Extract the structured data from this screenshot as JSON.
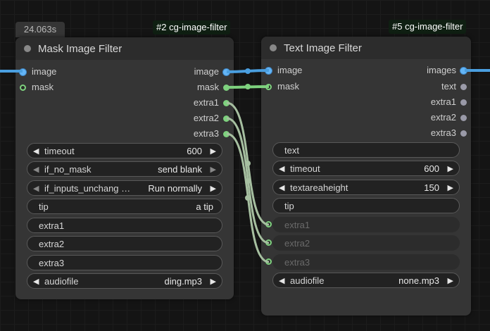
{
  "timer": "24.063s",
  "badges": {
    "node1": "#2 cg-image-filter",
    "node2": "#5 cg-image-filter"
  },
  "colors": {
    "image_wire": "#4a9fe0",
    "mask_wire": "#7ed17e",
    "extra_wire": "#a6bfa0",
    "node_bg": "#353535",
    "canvas_bg": "#141414"
  },
  "node1": {
    "title": "Mask Image Filter",
    "inputs": [
      {
        "label": "image",
        "type": "image"
      },
      {
        "label": "mask",
        "type": "mask"
      }
    ],
    "outputs": [
      {
        "label": "image",
        "type": "image"
      },
      {
        "label": "mask",
        "type": "mask"
      },
      {
        "label": "extra1",
        "type": "extra"
      },
      {
        "label": "extra2",
        "type": "extra"
      },
      {
        "label": "extra3",
        "type": "extra"
      }
    ],
    "widgets": [
      {
        "label": "timeout",
        "value": "600"
      },
      {
        "label": "if_no_mask",
        "value": "send blank"
      },
      {
        "label": "if_inputs_unchang …",
        "value": "Run normally"
      },
      {
        "label": "tip",
        "value": "a tip"
      },
      {
        "label": "extra1",
        "value": ""
      },
      {
        "label": "extra2",
        "value": ""
      },
      {
        "label": "extra3",
        "value": ""
      },
      {
        "label": "audiofile",
        "value": "ding.mp3"
      }
    ]
  },
  "node2": {
    "title": "Text Image Filter",
    "inputs": [
      {
        "label": "image",
        "type": "image"
      },
      {
        "label": "mask",
        "type": "mask"
      }
    ],
    "outputs": [
      {
        "label": "images",
        "type": "image"
      },
      {
        "label": "text",
        "type": "text"
      },
      {
        "label": "extra1",
        "type": "extra"
      },
      {
        "label": "extra2",
        "type": "extra"
      },
      {
        "label": "extra3",
        "type": "extra"
      }
    ],
    "widgets": [
      {
        "label": "text",
        "value": ""
      },
      {
        "label": "timeout",
        "value": "600"
      },
      {
        "label": "textareaheight",
        "value": "150"
      },
      {
        "label": "tip",
        "value": ""
      },
      {
        "label": "extra1",
        "value": ""
      },
      {
        "label": "extra2",
        "value": ""
      },
      {
        "label": "extra3",
        "value": ""
      },
      {
        "label": "audiofile",
        "value": "none.mp3"
      }
    ]
  }
}
